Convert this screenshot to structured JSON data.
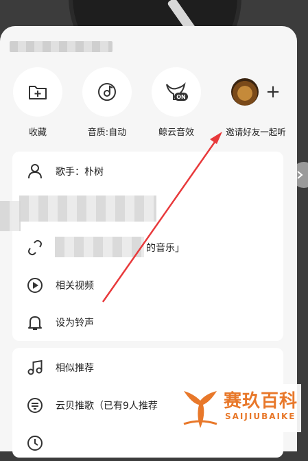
{
  "quick_actions": [
    {
      "label": "收藏",
      "icon": "folder-add-icon"
    },
    {
      "label": "音质:自动",
      "icon": "quality-icon"
    },
    {
      "label": "鲸云音效",
      "icon": "whale-sound-effect-icon"
    },
    {
      "label": "邀请好友一起听",
      "icon": "lion-avatar-icon"
    }
  ],
  "quality_badge": "ON",
  "invite_plus": "+",
  "menu_card1": {
    "items": [
      {
        "label": "歌手：朴树",
        "icon": "artist-icon"
      },
      {
        "label": "",
        "icon": "album-icon"
      },
      {
        "label": "的音乐」",
        "icon": "link-icon"
      },
      {
        "label": "相关视频",
        "icon": "video-icon"
      },
      {
        "label": "设为铃声",
        "icon": "bell-icon"
      }
    ]
  },
  "menu_card2": {
    "items": [
      {
        "label": "相似推荐",
        "icon": "music-note-icon"
      },
      {
        "label": "云贝推歌（已有9人推荐",
        "icon": "cloud-coin-icon"
      },
      {
        "label": "",
        "icon": "clock-icon"
      }
    ]
  },
  "watermark": {
    "cn": "赛玖百科",
    "en": "SAIJIUBAIKE"
  },
  "colors": {
    "sheet_bg": "#f6f6f6",
    "arrow": "#e8393b",
    "watermark": "#e8782a"
  }
}
